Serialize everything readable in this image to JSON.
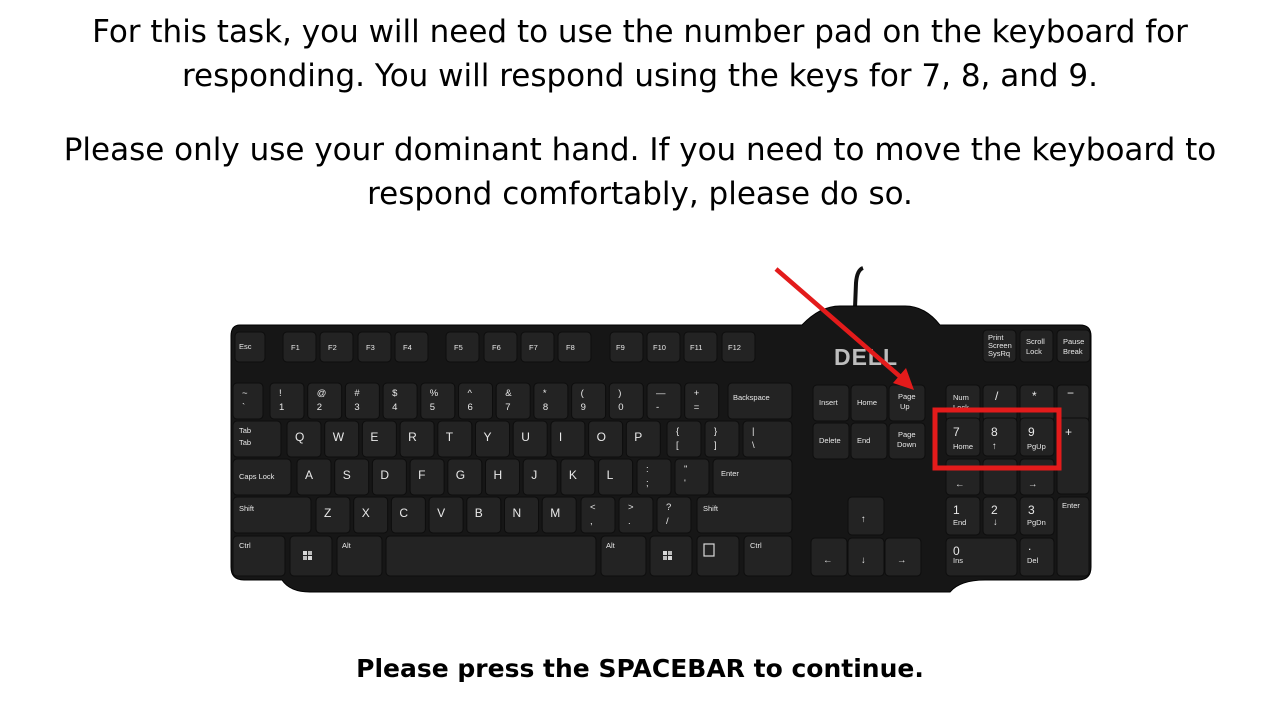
{
  "instructions": {
    "para1_line1": "For this task, you will need to use the number pad on the keyboard for",
    "para1_line2": "responding.  You will respond using the keys for 7, 8, and 9.",
    "para2_line1": "Please only use your dominant hand.  If you need to move the keyboard to",
    "para2_line2": "respond comfortably, please do so."
  },
  "footer": {
    "text": "Please press the SPACEBAR to continue."
  },
  "keyboard": {
    "brand": "DELL",
    "keys": {
      "esc": "Esc",
      "f1": "F1",
      "f2": "F2",
      "f3": "F3",
      "f4": "F4",
      "f5": "F5",
      "f6": "F6",
      "f7": "F7",
      "f8": "F8",
      "f9": "F9",
      "f10": "F10",
      "f11": "F11",
      "f12": "F12",
      "print_top": "Print",
      "print_mid": "Screen",
      "print_bot": "SysRq",
      "scroll_top": "Scroll",
      "scroll_bot": "Lock",
      "pause_top": "Pause",
      "pause_bot": "Break",
      "tilde_top": "~",
      "tilde_bot": "`",
      "n1_top": "!",
      "n1_bot": "1",
      "n2_top": "@",
      "n2_bot": "2",
      "n3_top": "#",
      "n3_bot": "3",
      "n4_top": "$",
      "n4_bot": "4",
      "n5_top": "%",
      "n5_bot": "5",
      "n6_top": "^",
      "n6_bot": "6",
      "n7_top": "&",
      "n7_bot": "7",
      "n8_top": "*",
      "n8_bot": "8",
      "n9_top": "(",
      "n9_bot": "9",
      "n0_top": ")",
      "n0_bot": "0",
      "minus_top": "—",
      "minus_bot": "-",
      "plus_top": "+",
      "plus_bot": "=",
      "backspace": "Backspace",
      "tab": "Tab",
      "q": "Q",
      "w": "W",
      "e": "E",
      "r": "R",
      "t": "T",
      "y": "Y",
      "u": "U",
      "i": "I",
      "o": "O",
      "p": "P",
      "lbrace_top": "{",
      "lbrace_bot": "[",
      "rbrace_top": "}",
      "rbrace_bot": "]",
      "pipe_top": "|",
      "pipe_bot": "\\",
      "caps": "Caps Lock",
      "a": "A",
      "s": "S",
      "d": "D",
      "f": "F",
      "g": "G",
      "h": "H",
      "j": "J",
      "k": "K",
      "l": "L",
      "colon_top": ":",
      "colon_bot": ";",
      "quote_top": "\"",
      "quote_bot": "'",
      "enter": "Enter",
      "shift": "Shift",
      "z": "Z",
      "x": "X",
      "c": "C",
      "v": "V",
      "b": "B",
      "n": "N",
      "m": "M",
      "lt_top": "<",
      "lt_bot": ",",
      "gt_top": ">",
      "gt_bot": ".",
      "q_top": "?",
      "q_bot": "/",
      "ctrl": "Ctrl",
      "alt": "Alt",
      "insert": "Insert",
      "home": "Home",
      "pageup_top": "Page",
      "pageup_bot": "Up",
      "delete": "Delete",
      "end": "End",
      "pagedown_top": "Page",
      "pagedown_bot": "Down",
      "numlock_top": "Num",
      "numlock_bot": "Lock",
      "np_slash": "/",
      "np_star": "*",
      "np_minus": "−",
      "np7": "7",
      "np7_sub": "Home",
      "np8": "8",
      "np8_sub": "↑",
      "np9": "9",
      "np9_sub": "PgUp",
      "np_plus": "+",
      "np4_sub": "←",
      "np6_sub": "→",
      "np1": "1",
      "np1_sub": "End",
      "np2": "2",
      "np2_sub": "↓",
      "np3": "3",
      "np3_sub": "PgDn",
      "np_enter": "Enter",
      "np0": "0",
      "np0_sub": "Ins",
      "np_dot": ".",
      "np_dot_sub": "Del",
      "up": "↑",
      "left": "←",
      "down": "↓",
      "right": "→"
    }
  },
  "colors": {
    "highlight": "#e31b1b",
    "keyboard_body": "#161616",
    "key_cap": "#232323"
  }
}
